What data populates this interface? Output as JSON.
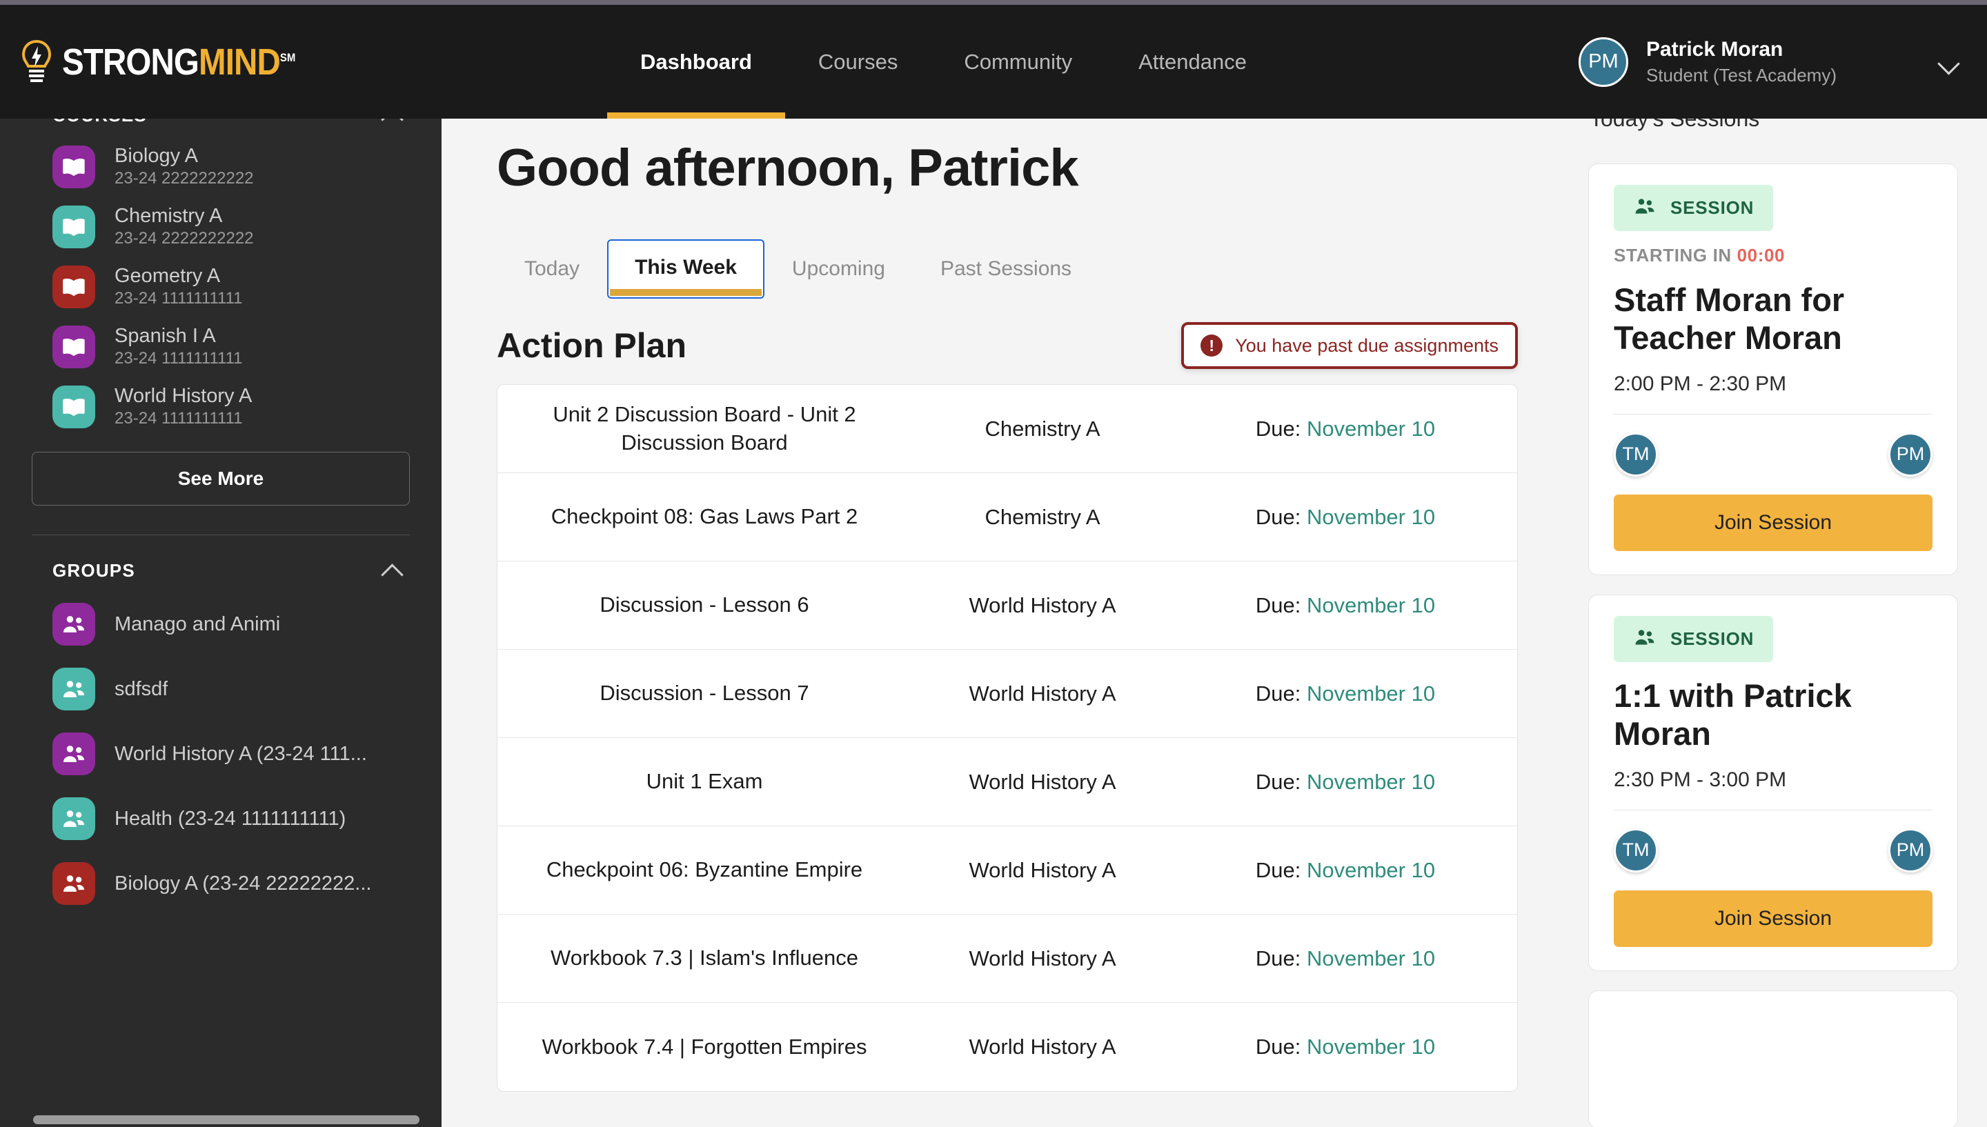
{
  "brand": {
    "name_strong": "STRONG",
    "name_mind": "MIND",
    "sm_mark": "SM",
    "accent": "#efb033",
    "bulb_icon": "lightbulb-icon"
  },
  "topnav": {
    "links": [
      {
        "label": "Dashboard",
        "active": true
      },
      {
        "label": "Courses",
        "active": false
      },
      {
        "label": "Community",
        "active": false
      },
      {
        "label": "Attendance",
        "active": false
      }
    ],
    "user": {
      "initials": "PM",
      "name": "Patrick Moran",
      "role": "Student (Test Academy)",
      "avatar_color": "#35748f"
    }
  },
  "sidebar": {
    "courses_header": "COURSES",
    "courses": [
      {
        "title": "Biology A",
        "code": "23-24 2222222222",
        "color": "#8e2a9b"
      },
      {
        "title": "Chemistry A",
        "code": "23-24 2222222222",
        "color": "#4cb8ac"
      },
      {
        "title": "Geometry A",
        "code": "23-24 1111111111",
        "color": "#a62823"
      },
      {
        "title": "Spanish I A",
        "code": "23-24 1111111111",
        "color": "#8e2a9b"
      },
      {
        "title": "World History A",
        "code": "23-24 1111111111",
        "color": "#4cb8ac"
      }
    ],
    "see_more_label": "See More",
    "groups_header": "GROUPS",
    "groups": [
      {
        "title": "Manago and Animi",
        "color": "#8e2a9b"
      },
      {
        "title": "sdfsdf",
        "color": "#4cb8ac"
      },
      {
        "title": "World History A (23-24 111...",
        "color": "#8e2a9b"
      },
      {
        "title": "Health (23-24 1111111111)",
        "color": "#4cb8ac"
      },
      {
        "title": "Biology A (23-24 22222222...",
        "color": "#a62823"
      }
    ]
  },
  "main": {
    "greeting": "Good afternoon, Patrick",
    "tabs": [
      {
        "label": "Today",
        "active": false
      },
      {
        "label": "This Week",
        "active": true
      },
      {
        "label": "Upcoming",
        "active": false
      },
      {
        "label": "Past Sessions",
        "active": false
      }
    ],
    "action_plan_title": "Action Plan",
    "past_due": {
      "label": "You have past due assignments",
      "icon": "alert-circle-icon",
      "color": "#8a2522"
    },
    "due_prefix": "Due: ",
    "date_color": "#2f8c7c",
    "assignments": [
      {
        "name": "Unit 2 Discussion Board - Unit 2 Discussion Board",
        "course": "Chemistry A",
        "due": "November 10"
      },
      {
        "name": "Checkpoint 08: Gas Laws Part 2",
        "course": "Chemistry A",
        "due": "November 10"
      },
      {
        "name": "Discussion - Lesson 6",
        "course": "World History A",
        "due": "November 10"
      },
      {
        "name": "Discussion - Lesson 7",
        "course": "World History A",
        "due": "November 10"
      },
      {
        "name": "Unit 1 Exam",
        "course": "World History A",
        "due": "November 10"
      },
      {
        "name": "Checkpoint 06: Byzantine Empire",
        "course": "World History A",
        "due": "November 10"
      },
      {
        "name": "Workbook 7.3 | Islam's Influence",
        "course": "World History A",
        "due": "November 10"
      },
      {
        "name": "Workbook 7.4 | Forgotten Empires",
        "course": "World History A",
        "due": "November 10"
      }
    ]
  },
  "rightbar": {
    "title": "Today's Sessions",
    "sessions": [
      {
        "badge_label": "SESSION",
        "badge_icon": "people-icon",
        "starting_label": "STARTING IN ",
        "countdown": "00:00",
        "name": "Staff Moran for Teacher Moran",
        "time": "2:00 PM - 2:30 PM",
        "attendee_left": "TM",
        "attendee_right": "PM",
        "join_label": "Join Session"
      },
      {
        "badge_label": "SESSION",
        "badge_icon": "people-icon",
        "starting_label": "",
        "countdown": "",
        "name": "1:1 with Patrick Moran",
        "time": "2:30 PM - 3:00 PM",
        "attendee_left": "TM",
        "attendee_right": "PM",
        "join_label": "Join Session"
      }
    ]
  }
}
